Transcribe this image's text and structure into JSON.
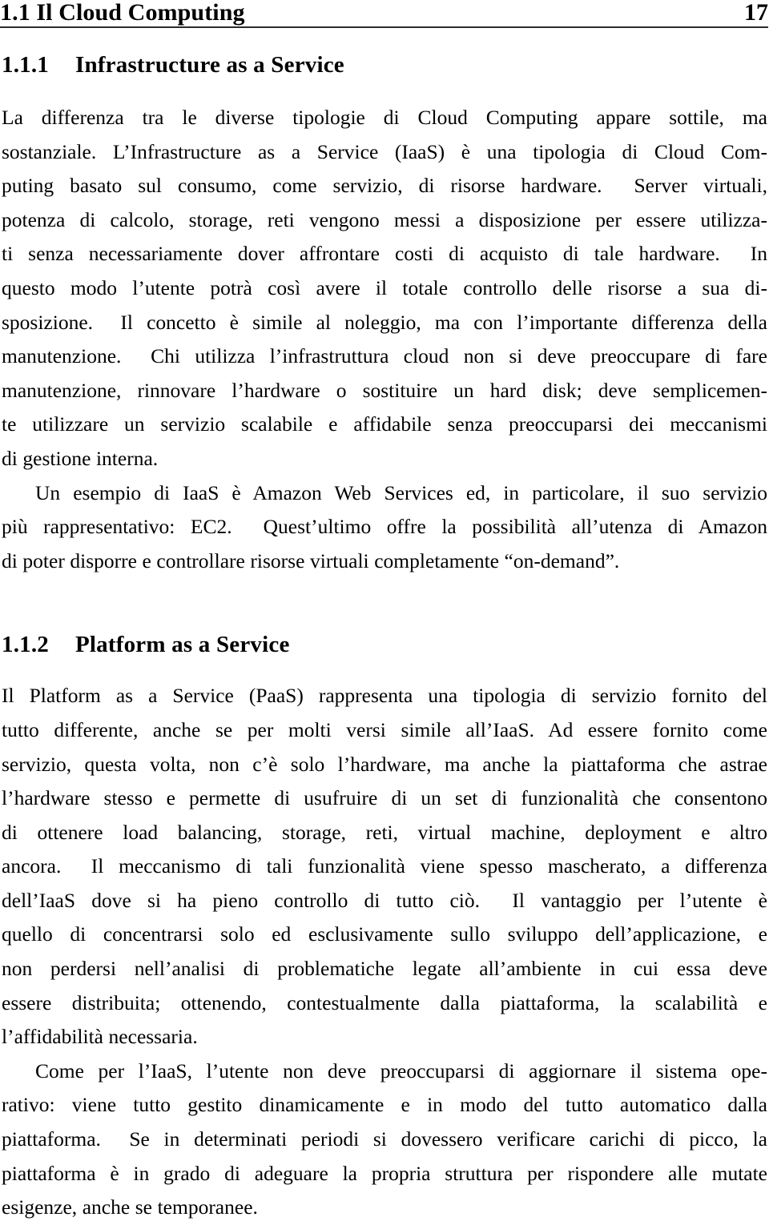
{
  "header": {
    "title": "1.1 Il Cloud Computing",
    "page_number": "17",
    "rule_color": "#2b2b2b"
  },
  "sections": [
    {
      "number": "1.1.1",
      "title": "Infrastructure as a Service",
      "paragraphs": [
        {
          "indent": false,
          "lines": [
            "La differenza tra le diverse tipologie di Cloud Computing appare sottile, ma",
            "sostanziale. L’Infrastructure as a Service (IaaS) è una tipologia di Cloud Com-",
            "puting basato sul consumo, come servizio, di risorse hardware.  Server virtuali,",
            "potenza di calcolo, storage, reti vengono messi a disposizione per essere utilizza-",
            "ti senza necessariamente dover affrontare costi di acquisto di tale hardware.  In",
            "questo modo l’utente potrà così avere il totale controllo delle risorse a sua di-",
            "sposizione.  Il concetto è simile al noleggio, ma con l’importante differenza della",
            "manutenzione.  Chi utilizza l’infrastruttura cloud non si deve preoccupare di fare",
            "manutenzione, rinnovare l’hardware o sostituire un hard disk; deve semplicemen-",
            "te utilizzare un servizio scalabile e affidabile senza preoccuparsi dei meccanismi",
            "di gestione interna."
          ]
        },
        {
          "indent": true,
          "lines": [
            "Un esempio di IaaS è Amazon Web Services ed, in particolare, il suo servizio",
            "più rappresentativo: EC2.  Quest’ultimo offre la possibilità all’utenza di Amazon",
            "di poter disporre e controllare risorse virtuali completamente “on-demand”."
          ]
        }
      ]
    },
    {
      "number": "1.1.2",
      "title": "Platform as a Service",
      "paragraphs": [
        {
          "indent": false,
          "lines": [
            "Il Platform as a Service (PaaS) rappresenta una tipologia di servizio fornito del",
            "tutto differente, anche se per molti versi simile all’IaaS. Ad essere fornito come",
            "servizio, questa volta, non c’è solo l’hardware, ma anche la piattaforma che astrae",
            "l’hardware stesso e permette di usufruire di un set di funzionalità che consentono",
            "di ottenere load balancing, storage, reti, virtual machine, deployment e altro",
            "ancora.  Il meccanismo di tali funzionalità viene spesso mascherato, a differenza",
            "dell’IaaS dove si ha pieno controllo di tutto ciò.  Il vantaggio per l’utente è",
            "quello di concentrarsi solo ed esclusivamente sullo sviluppo dell’applicazione, e",
            "non perdersi nell’analisi di problematiche legate all’ambiente in cui essa deve",
            "essere distribuita; ottenendo, contestualmente dalla piattaforma, la scalabilità e",
            "l’affidabilità necessaria."
          ]
        },
        {
          "indent": true,
          "lines": [
            "Come per l’IaaS, l’utente non deve preoccuparsi di aggiornare il sistema ope-",
            "rativo: viene tutto gestito dinamicamente e in modo del tutto automatico dalla",
            "piattaforma.  Se in determinati periodi si dovessero verificare carichi di picco, la",
            "piattaforma è in grado di adeguare la propria struttura per rispondere alle mutate",
            "esigenze, anche se temporanee."
          ]
        }
      ]
    }
  ]
}
